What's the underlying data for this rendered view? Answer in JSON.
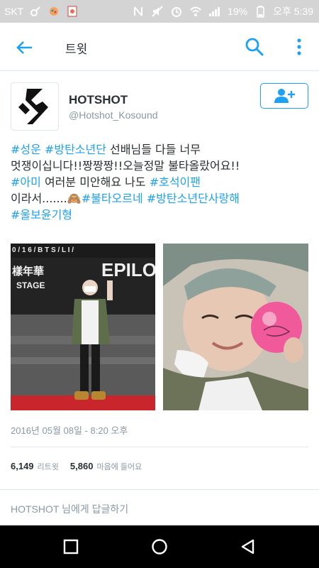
{
  "status_bar": {
    "carrier": "SKT",
    "battery": "19%",
    "time": "오후 5:39"
  },
  "app_bar": {
    "title": "트윗",
    "back_icon": "arrow-left-icon",
    "search_icon": "search-icon",
    "more_icon": "more-vertical-icon"
  },
  "tweet": {
    "author_name": "HOTSHOT",
    "author_handle": "@Hotshot_Kosound",
    "follow_icon": "follow-user-icon",
    "text_lines": [
      [
        {
          "t": "#성운",
          "h": true
        },
        {
          "t": " ",
          "h": false
        },
        {
          "t": "#방탄소년단",
          "h": true
        },
        {
          "t": " 선배님들 다들 너무",
          "h": false
        }
      ],
      [
        {
          "t": "멋쟁이십니다!!짱짱짱!!오늘정말 불타올랐어요!!",
          "h": false
        }
      ],
      [
        {
          "t": "#아미",
          "h": true
        },
        {
          "t": " 여러분 미안해요 나도 ",
          "h": false
        },
        {
          "t": "#호석이팬",
          "h": true
        }
      ],
      [
        {
          "t": "이라서.......🙈",
          "h": false
        },
        {
          "t": "#불타오르네",
          "h": true
        },
        {
          "t": " ",
          "h": false
        },
        {
          "t": "#방탄소년단사랑해",
          "h": true
        }
      ],
      [
        {
          "t": "#울보윤기형",
          "h": true
        }
      ]
    ],
    "photo1": {
      "banner_text": "0 / 1 6 / B T S / L I /",
      "sign_left": "樣年華",
      "sign_stage": "STAGE",
      "sign_right": "EPILOG"
    },
    "timestamp": "2016년 05월 08일 - 8:20 오후",
    "retweet_count": "6,149",
    "retweet_label": "리트윗",
    "like_count": "5,860",
    "like_label": "마음에 들어요",
    "reply_placeholder": "HOTSHOT 님에게 답글하기"
  },
  "nav_bar": {
    "recent_icon": "square-icon",
    "home_icon": "circle-icon",
    "back_icon": "triangle-back-icon"
  },
  "colors": {
    "accent": "#1da1f2",
    "text": "#292f33",
    "muted": "#8899a6",
    "status_bar": "#d4d4d4"
  }
}
